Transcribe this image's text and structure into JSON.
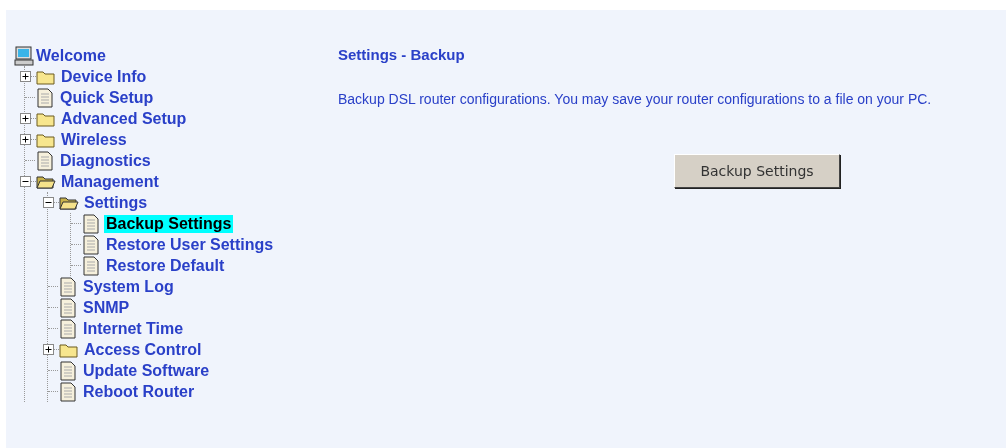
{
  "tree": {
    "label": "Welcome",
    "children": [
      {
        "label": "Device Info",
        "kind": "folder",
        "expanded": false,
        "selected": false
      },
      {
        "label": "Quick Setup",
        "kind": "page",
        "selected": false
      },
      {
        "label": "Advanced Setup",
        "kind": "folder",
        "expanded": false,
        "selected": false
      },
      {
        "label": "Wireless",
        "kind": "folder",
        "expanded": false,
        "selected": false
      },
      {
        "label": "Diagnostics",
        "kind": "page",
        "selected": false
      },
      {
        "label": "Management",
        "kind": "folder",
        "expanded": true,
        "selected": false,
        "children": [
          {
            "label": "Settings",
            "kind": "folder",
            "expanded": true,
            "selected": false,
            "children": [
              {
                "label": "Backup Settings",
                "kind": "page",
                "selected": true
              },
              {
                "label": "Restore User Settings",
                "kind": "page",
                "selected": false
              },
              {
                "label": "Restore Default",
                "kind": "page",
                "selected": false
              }
            ]
          },
          {
            "label": "System Log",
            "kind": "page",
            "selected": false
          },
          {
            "label": "SNMP",
            "kind": "page",
            "selected": false
          },
          {
            "label": "Internet Time",
            "kind": "page",
            "selected": false
          },
          {
            "label": "Access Control",
            "kind": "folder",
            "expanded": false,
            "selected": false
          },
          {
            "label": "Update Software",
            "kind": "page",
            "selected": false
          },
          {
            "label": "Reboot Router",
            "kind": "page",
            "selected": false
          }
        ]
      }
    ]
  },
  "content": {
    "title": "Settings - Backup",
    "description": "Backup DSL router configurations. You may save your router configurations to a file on your PC.",
    "button": "Backup Settings"
  }
}
